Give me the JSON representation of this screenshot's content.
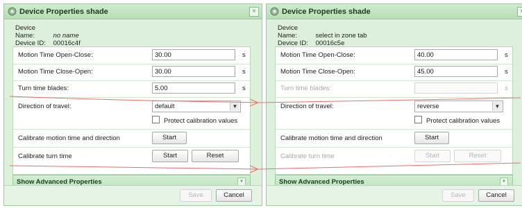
{
  "dialogs": [
    {
      "title": "Device Properties shade",
      "close_glyph": "×",
      "device_name_label": "Device Name:",
      "device_name_value": "no name",
      "device_id_label": "Device ID:",
      "device_id_value": "00016c4f",
      "motion_open_close_label": "Motion Time Open-Close:",
      "motion_open_close_value": "30.00",
      "motion_close_open_label": "Motion Time Close-Open:",
      "motion_close_open_value": "30.00",
      "turn_time_label": "Turn time blades:",
      "turn_time_value": "5.00",
      "unit": "s",
      "direction_label": "Direction of travel:",
      "direction_value": "default",
      "protect_label": "Protect calibration values",
      "calibrate_motion_label": "Calibrate motion time and direction",
      "calibrate_turn_label": "Calibrate turn time",
      "start_label": "Start",
      "reset_label": "Reset",
      "advanced_label": "Show Advanced Properties",
      "save_label": "Save",
      "cancel_label": "Cancel",
      "turn_disabled": false
    },
    {
      "title": "Device Properties shade",
      "close_glyph": "×",
      "device_name_label": "Device Name:",
      "device_name_value": "select in zone tab",
      "device_id_label": "Device ID:",
      "device_id_value": "00016c5e",
      "motion_open_close_label": "Motion Time Open-Close:",
      "motion_open_close_value": "40.00",
      "motion_close_open_label": "Motion Time Close-Open:",
      "motion_close_open_value": "45.00",
      "turn_time_label": "Turn time blades:",
      "turn_time_value": "",
      "unit": "s",
      "direction_label": "Direction of travel:",
      "direction_value": "reverse",
      "protect_label": "Protect calibration values",
      "calibrate_motion_label": "Calibrate motion time and direction",
      "calibrate_turn_label": "Calibrate turn time",
      "start_label": "Start",
      "reset_label": "Reset",
      "advanced_label": "Show Advanced Properties",
      "save_label": "Save",
      "cancel_label": "Cancel",
      "turn_disabled": true
    }
  ],
  "colors": {
    "annotation": "#f06a6a",
    "dialog_background": "#dcf0dc",
    "titlebar": "#b6dfb6"
  }
}
